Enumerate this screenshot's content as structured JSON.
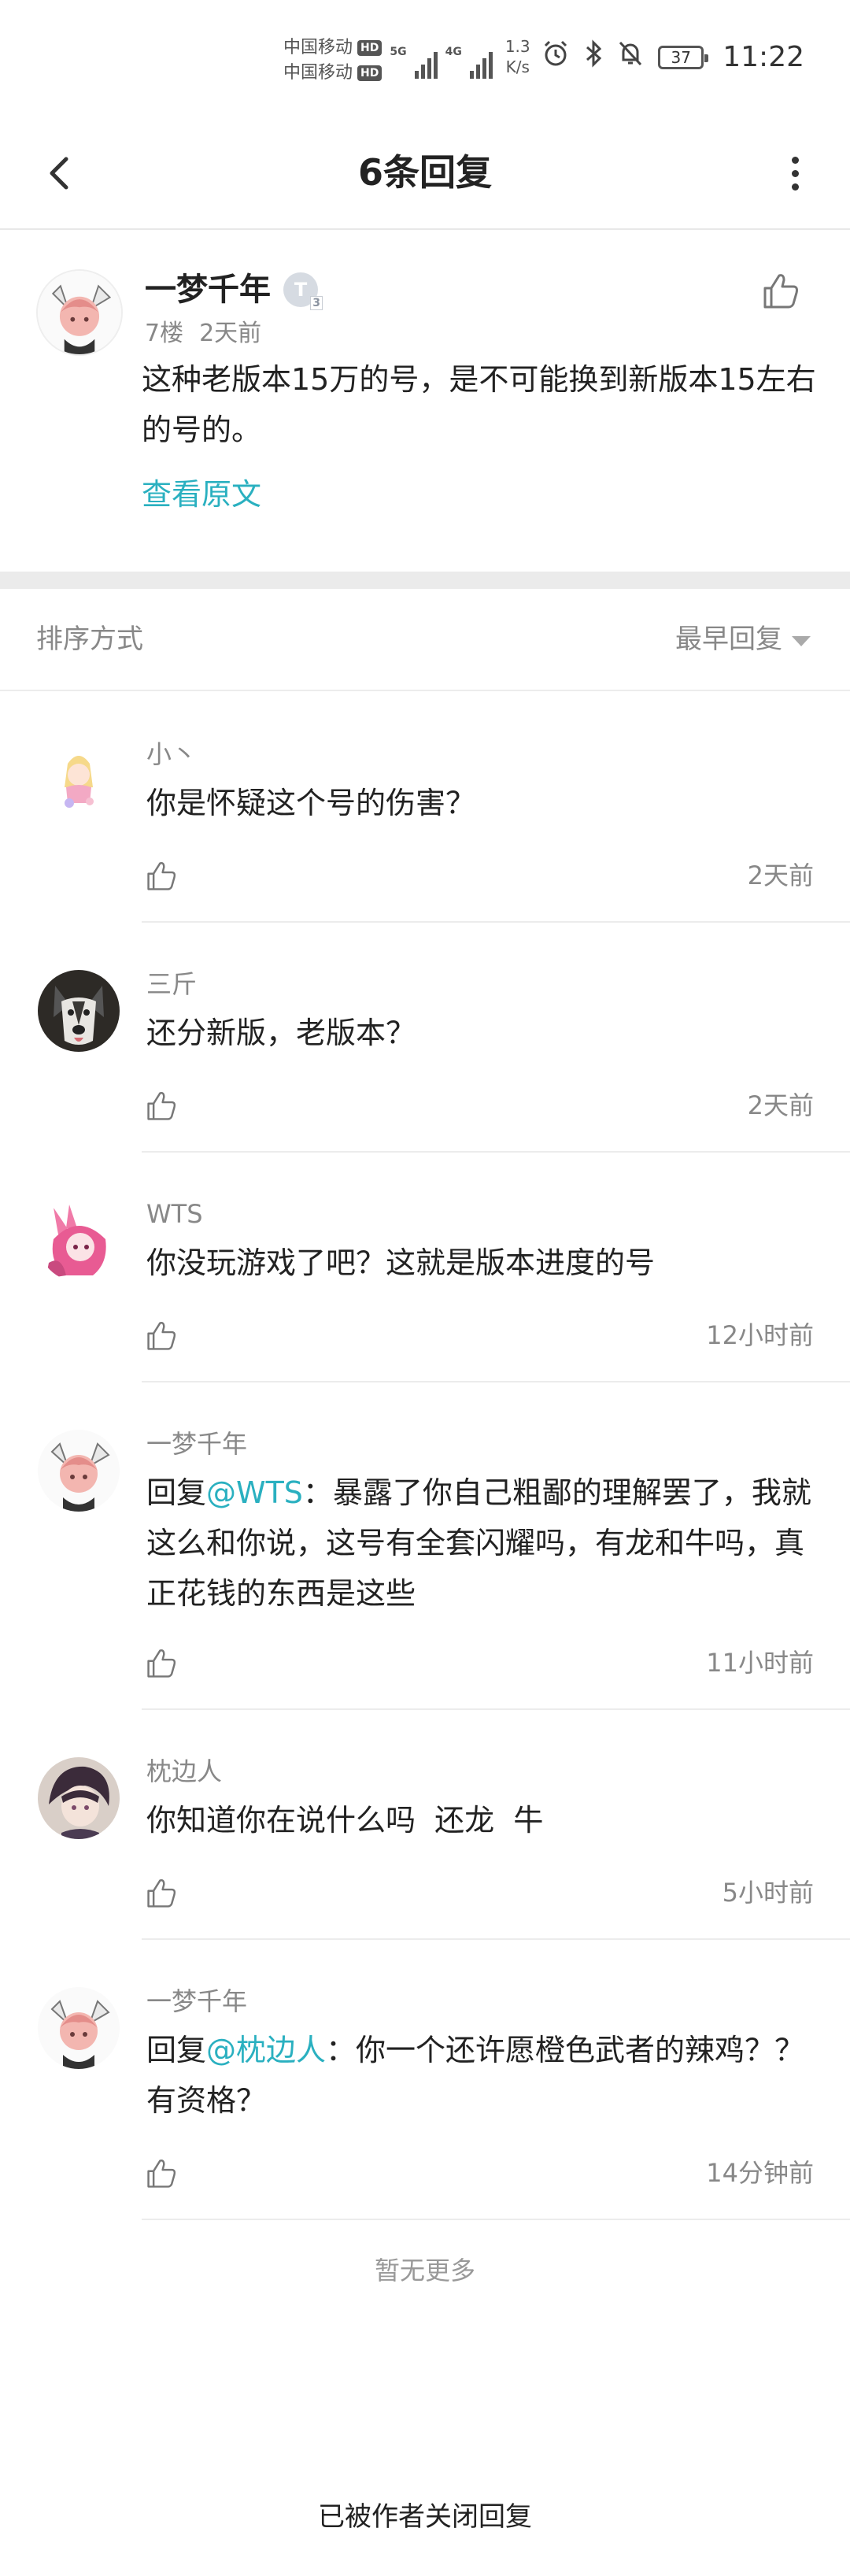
{
  "status_bar": {
    "carrier_1": "中国移动",
    "carrier_2": "中国移动",
    "hd_badge": "HD",
    "net_1": "5G",
    "net_2": "4G",
    "speed_value": "1.3",
    "speed_unit": "K/s",
    "battery": "37",
    "time": "11:22",
    "icons": [
      "alarm-icon",
      "bluetooth-icon",
      "mute-icon",
      "battery-icon"
    ]
  },
  "header": {
    "title": "6条回复",
    "back_icon": "chevron-left-icon",
    "more_icon": "more-vertical-icon"
  },
  "post": {
    "author": "一梦千年",
    "level_badge": "T",
    "floor": "7楼",
    "time": "2天前",
    "content": "这种老版本15万的号，是不可能换到新版本15左右的号的。",
    "view_original": "查看原文"
  },
  "sort": {
    "label": "排序方式",
    "value": "最早回复"
  },
  "replies": [
    {
      "author": "小丶",
      "text": "你是怀疑这个号的伤害？",
      "time": "2天前"
    },
    {
      "author": "三斤",
      "text": "还分新版，老版本？",
      "time": "2天前"
    },
    {
      "author": "WTS",
      "text": "你没玩游戏了吧？这就是版本进度的号",
      "time": "12小时前"
    },
    {
      "author": "一梦千年",
      "reply_prefix": "回复",
      "mention": "@WTS",
      "text": "：暴露了你自己粗鄙的理解罢了，我就这么和你说，这号有全套闪耀吗，有龙和牛吗，真正花钱的东西是这些",
      "time": "11小时前"
    },
    {
      "author": "枕边人",
      "text": "你知道你在说什么吗  还龙  牛",
      "time": "5小时前"
    },
    {
      "author": "一梦千年",
      "reply_prefix": "回复",
      "mention": "@枕边人",
      "text": "：你一个还许愿橙色武者的辣鸡？？有资格？",
      "time": "14分钟前"
    }
  ],
  "footer": {
    "no_more": "暂无更多",
    "closed_notice": "已被作者关闭回复"
  },
  "colors": {
    "accent": "#2ab0c0",
    "muted_text": "#888888",
    "divider": "#ececec"
  }
}
